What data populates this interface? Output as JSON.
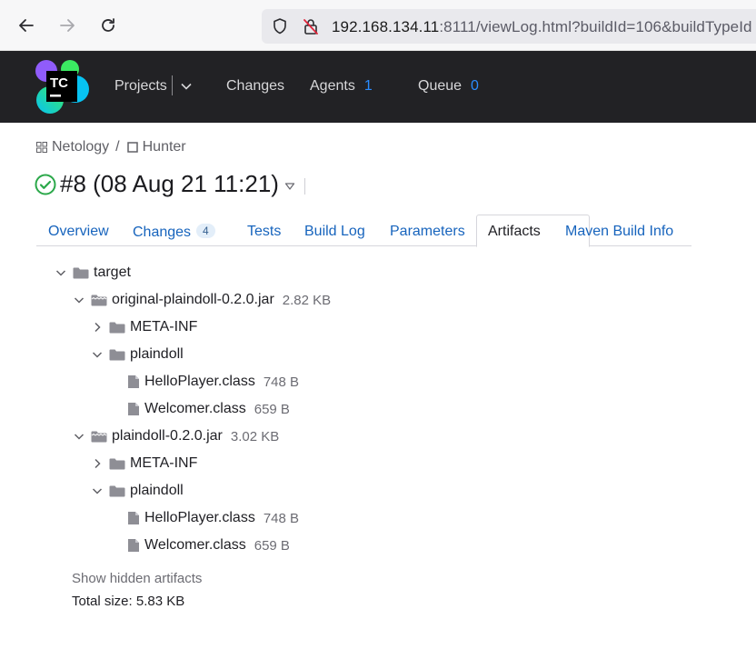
{
  "browser": {
    "url_host": "192.168.134.11",
    "url_rest": ":8111/viewLog.html?buildId=106&buildTypeId"
  },
  "header": {
    "logo_text": "TC",
    "nav": {
      "projects": "Projects",
      "changes": "Changes",
      "agents": "Agents",
      "agents_count": "1",
      "queue": "Queue",
      "queue_count": "0"
    }
  },
  "breadcrumb": {
    "project": "Netology",
    "separator": "/",
    "build_config": "Hunter"
  },
  "build": {
    "title": "#8 (08 Aug 21 11:21)",
    "status": "success"
  },
  "tabs": [
    {
      "label": "Overview"
    },
    {
      "label": "Changes",
      "badge": "4"
    },
    {
      "label": "Tests"
    },
    {
      "label": "Build Log"
    },
    {
      "label": "Parameters"
    },
    {
      "label": "Artifacts",
      "active": true
    },
    {
      "label": "Maven Build Info"
    }
  ],
  "tree": {
    "root": {
      "name": "target"
    },
    "jar1": {
      "name": "original-plaindoll-0.2.0.jar",
      "size": "2.82 KB"
    },
    "jar1_meta": {
      "name": "META-INF"
    },
    "jar1_pkg": {
      "name": "plaindoll"
    },
    "jar1_file1": {
      "name": "HelloPlayer.class",
      "size": "748 B"
    },
    "jar1_file2": {
      "name": "Welcomer.class",
      "size": "659 B"
    },
    "jar2": {
      "name": "plaindoll-0.2.0.jar",
      "size": "3.02 KB"
    },
    "jar2_meta": {
      "name": "META-INF"
    },
    "jar2_pkg": {
      "name": "plaindoll"
    },
    "jar2_file1": {
      "name": "HelloPlayer.class",
      "size": "748 B"
    },
    "jar2_file2": {
      "name": "Welcomer.class",
      "size": "659 B"
    }
  },
  "footer": {
    "show_hidden": "Show hidden artifacts",
    "total_size": "Total size: 5.83 KB"
  },
  "colors": {
    "header_bg": "#222225",
    "link": "#1764bd",
    "count": "#2a8cff",
    "success": "#2ba84a"
  }
}
